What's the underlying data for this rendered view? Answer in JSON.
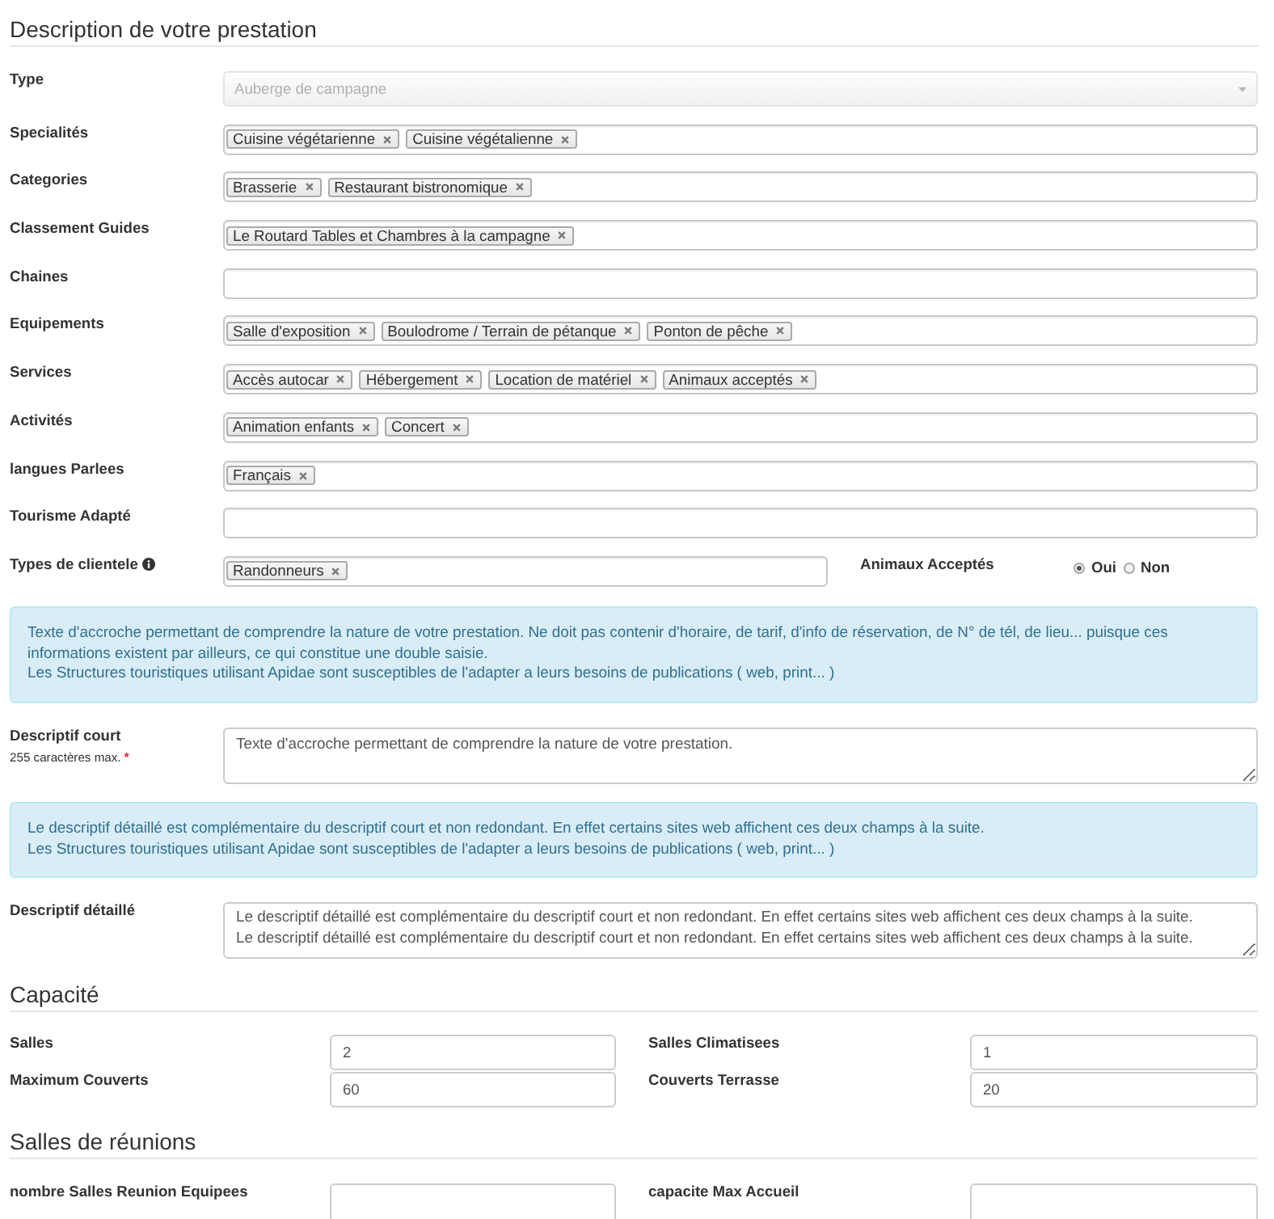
{
  "description": {
    "title": "Description de votre prestation",
    "fields": [
      {
        "kind": "select",
        "label": "Type",
        "value": "Auberge de campagne",
        "disabled": true
      },
      {
        "kind": "tags",
        "label": "Specialités",
        "tags": [
          "Cuisine végétarienne",
          "Cuisine végétalienne"
        ]
      },
      {
        "kind": "tags",
        "label": "Categories",
        "tags": [
          "Brasserie",
          "Restaurant bistronomique"
        ]
      },
      {
        "kind": "tags",
        "label": "Classement Guides",
        "tags": [
          "Le Routard Tables et Chambres à la campagne"
        ]
      },
      {
        "kind": "tags",
        "label": "Chaines"
      },
      {
        "kind": "tags",
        "label": "Equipements",
        "tags": [
          "Salle d'exposition",
          "Boulodrome / Terrain de pétanque",
          "Ponton de pêche"
        ]
      },
      {
        "kind": "tags",
        "label": "Services",
        "tags": [
          "Accès autocar",
          "Hébergement",
          "Location de matériel",
          "Animaux acceptés"
        ]
      },
      {
        "kind": "tags",
        "label": "Activités",
        "tags": [
          "Animation enfants",
          "Concert"
        ]
      },
      {
        "kind": "tags",
        "label": "langues Parlees",
        "tags": [
          "Français"
        ]
      },
      {
        "kind": "tags",
        "label": "Tourisme Adapté"
      }
    ]
  },
  "clientele_row": {
    "label": "Types de clientele",
    "tags": [
      "Randonneurs"
    ],
    "radio_group": {
      "label": "Animaux Acceptés",
      "options": [
        {
          "label": "Oui",
          "selected": true
        },
        {
          "label": "Non",
          "selected": false
        }
      ]
    }
  },
  "hint_short": {
    "paragraphs": [
      "Texte d'accroche permettant de comprendre la nature de votre prestation. Ne doit pas contenir d'horaire, de tarif, d'info de réservation, de N° de tél, de lieu... puisque ces informations existent par ailleurs, ce qui constitue une double saisie.",
      "Les Structures touristiques utilisant Apidae sont susceptibles de l'adapter a leurs besoins de publications ( web, print... )"
    ]
  },
  "descriptif_court": {
    "label": "Descriptif court",
    "note": "255 caractères max.",
    "required_mark": "*",
    "value": "Texte d'accroche permettant de comprendre la nature de votre prestation."
  },
  "hint_detailed": {
    "paragraphs": [
      "Le descriptif détaillé est complémentaire du descriptif court et non redondant. En effet certains sites web affichent ces deux champs à la suite.",
      "Les Structures touristiques utilisant Apidae sont susceptibles de l'adapter a leurs besoins de publications ( web, print... )"
    ]
  },
  "descriptif_detaille": {
    "label": "Descriptif détaillé",
    "value": "Le descriptif détaillé est complémentaire du descriptif court et non redondant. En effet certains sites web affichent ces deux champs à la suite.\nLe descriptif détaillé est complémentaire du descriptif court et non redondant. En effet certains sites web affichent ces deux champs à la suite."
  },
  "capacite": {
    "title": "Capacité",
    "fields": [
      {
        "label": "Salles",
        "value": "2"
      },
      {
        "label": "Salles Climatisees",
        "value": "1"
      },
      {
        "label": "Maximum Couverts",
        "value": "60"
      },
      {
        "label": "Couverts Terrasse",
        "value": "20"
      }
    ]
  },
  "salles_reunions": {
    "title": "Salles de réunions",
    "fields": [
      {
        "label": "nombre Salles Reunion Equipees"
      },
      {
        "label": "capacite Max Accueil"
      }
    ]
  }
}
